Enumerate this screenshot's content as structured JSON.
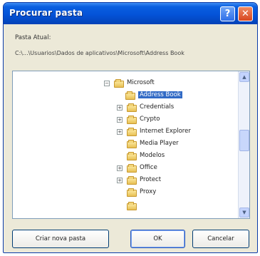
{
  "window": {
    "title": "Procurar pasta",
    "help_label": "?",
    "close_label": "✕"
  },
  "current_folder": {
    "label": "Pasta Atual:",
    "path": "C:\\...\\Usuarios\\Dados de aplicativos\\Microsoft\\Address Book"
  },
  "tree": {
    "items": [
      {
        "label": "Microsoft",
        "expander": "−"
      },
      {
        "label": "Address Book",
        "expander": ""
      },
      {
        "label": "Credentials",
        "expander": "+"
      },
      {
        "label": "Crypto",
        "expander": "+"
      },
      {
        "label": "Internet Explorer",
        "expander": "+"
      },
      {
        "label": "Media Player",
        "expander": ""
      },
      {
        "label": "Modelos",
        "expander": ""
      },
      {
        "label": "Office",
        "expander": "+"
      },
      {
        "label": "Protect",
        "expander": "+"
      },
      {
        "label": "Proxy",
        "expander": ""
      }
    ]
  },
  "buttons": {
    "new_folder": "Criar nova pasta",
    "ok": "OK",
    "cancel": "Cancelar"
  }
}
